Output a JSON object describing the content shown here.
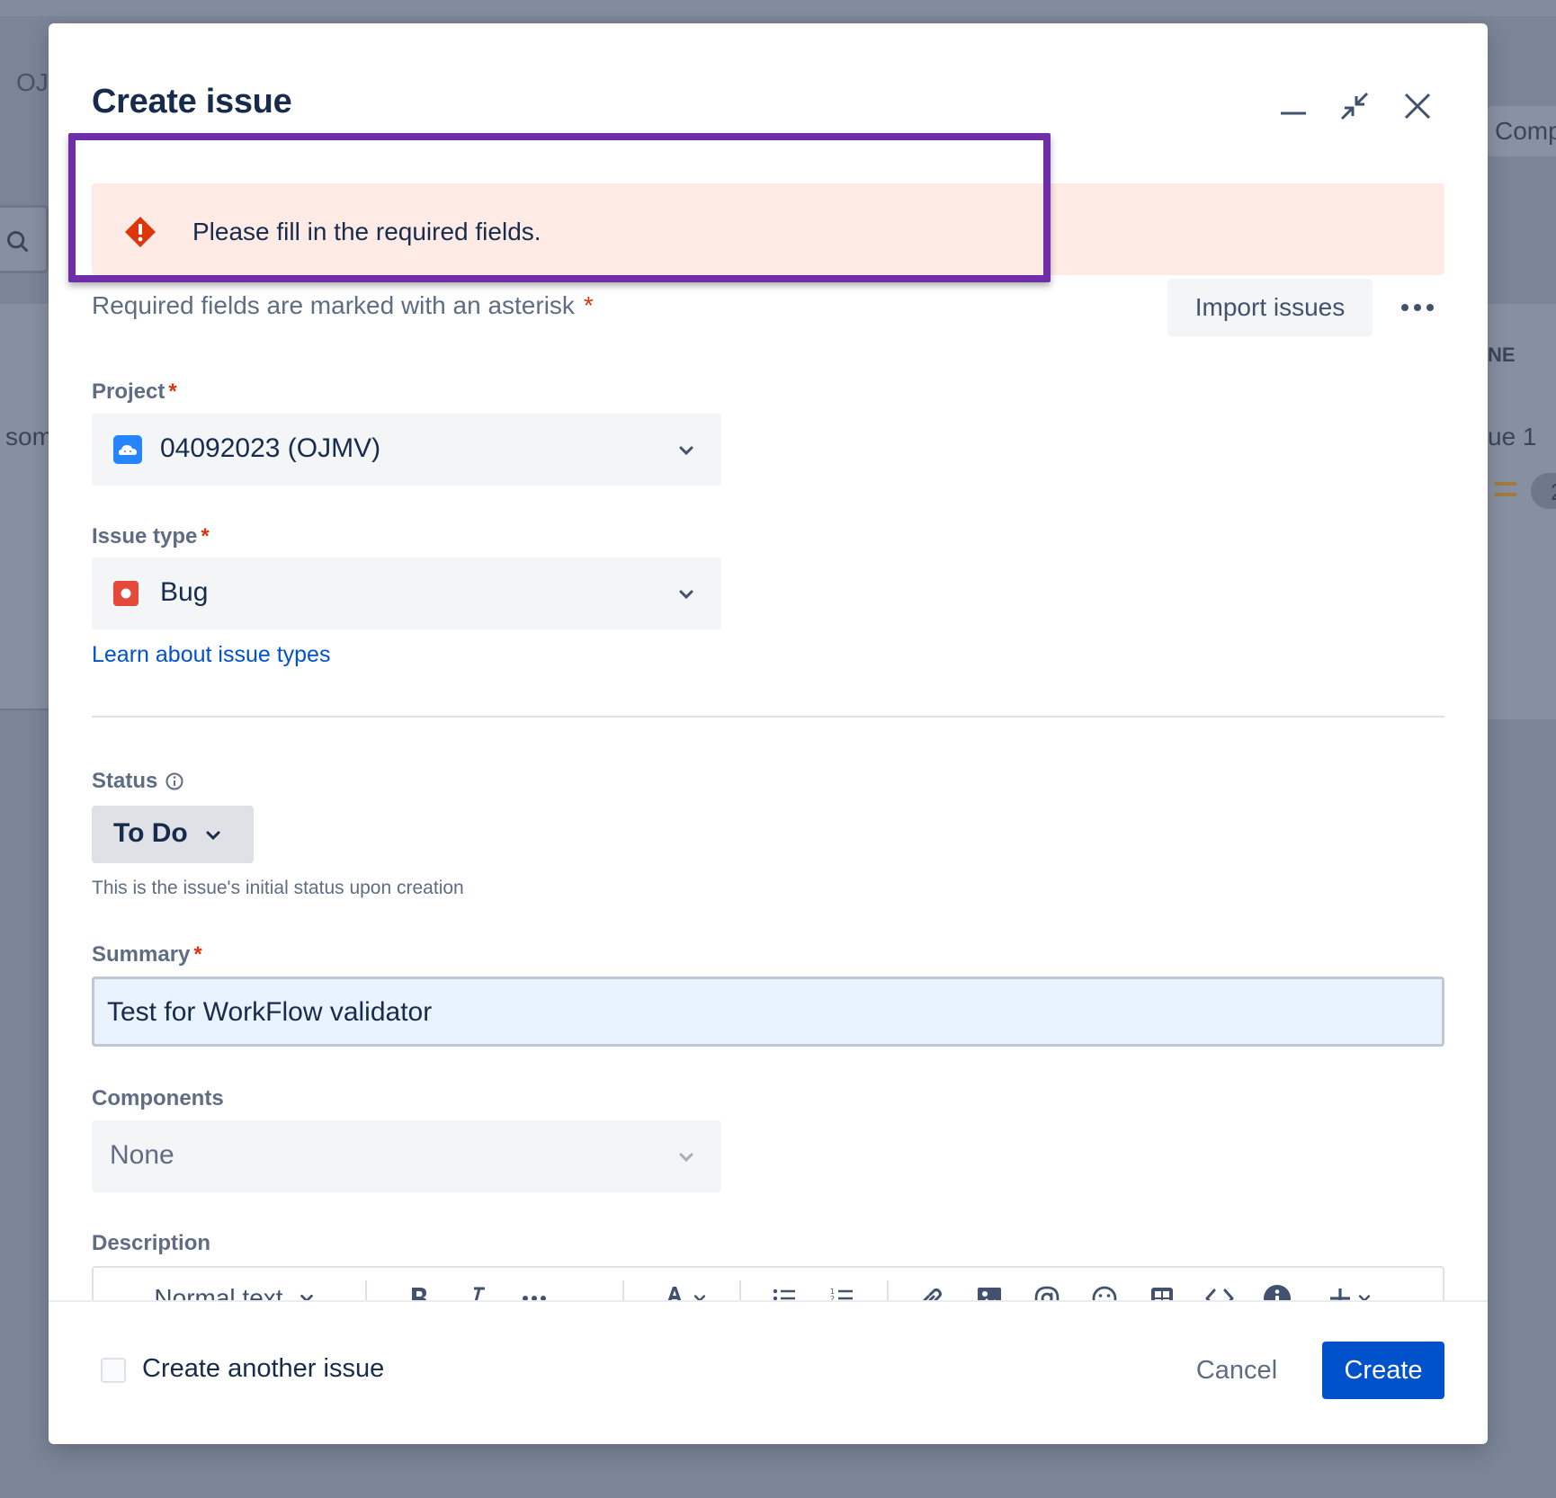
{
  "background": {
    "left_top_text": "OJ",
    "left_mid_text": "som",
    "right_top_text": "Comp",
    "right_col_text": "NE",
    "right_row_text": "ue 1",
    "right_avatar_text": "2"
  },
  "modal": {
    "title": "Create issue",
    "error_banner": {
      "message": "Please fill in the required fields."
    },
    "required_note": "Required fields are marked with an asterisk",
    "asterisk": "*",
    "import_label": "Import issues",
    "fields": {
      "project": {
        "label": "Project",
        "value": "04092023 (OJMV)"
      },
      "issue_type": {
        "label": "Issue type",
        "value": "Bug",
        "link": "Learn about issue types"
      },
      "status": {
        "label": "Status",
        "value": "To Do",
        "help": "This is the issue's initial status upon creation"
      },
      "summary": {
        "label": "Summary",
        "value": "Test for WorkFlow validator"
      },
      "components": {
        "label": "Components",
        "value": "None"
      },
      "description": {
        "label": "Description",
        "text_style": "Normal text"
      }
    },
    "footer": {
      "create_another_label": "Create another issue",
      "cancel_label": "Cancel",
      "create_label": "Create"
    }
  },
  "colors": {
    "primary": "#0052CC",
    "error_bg": "#FFEBE6",
    "error_icon": "#DE350B",
    "highlight": "#6F2DA8"
  }
}
